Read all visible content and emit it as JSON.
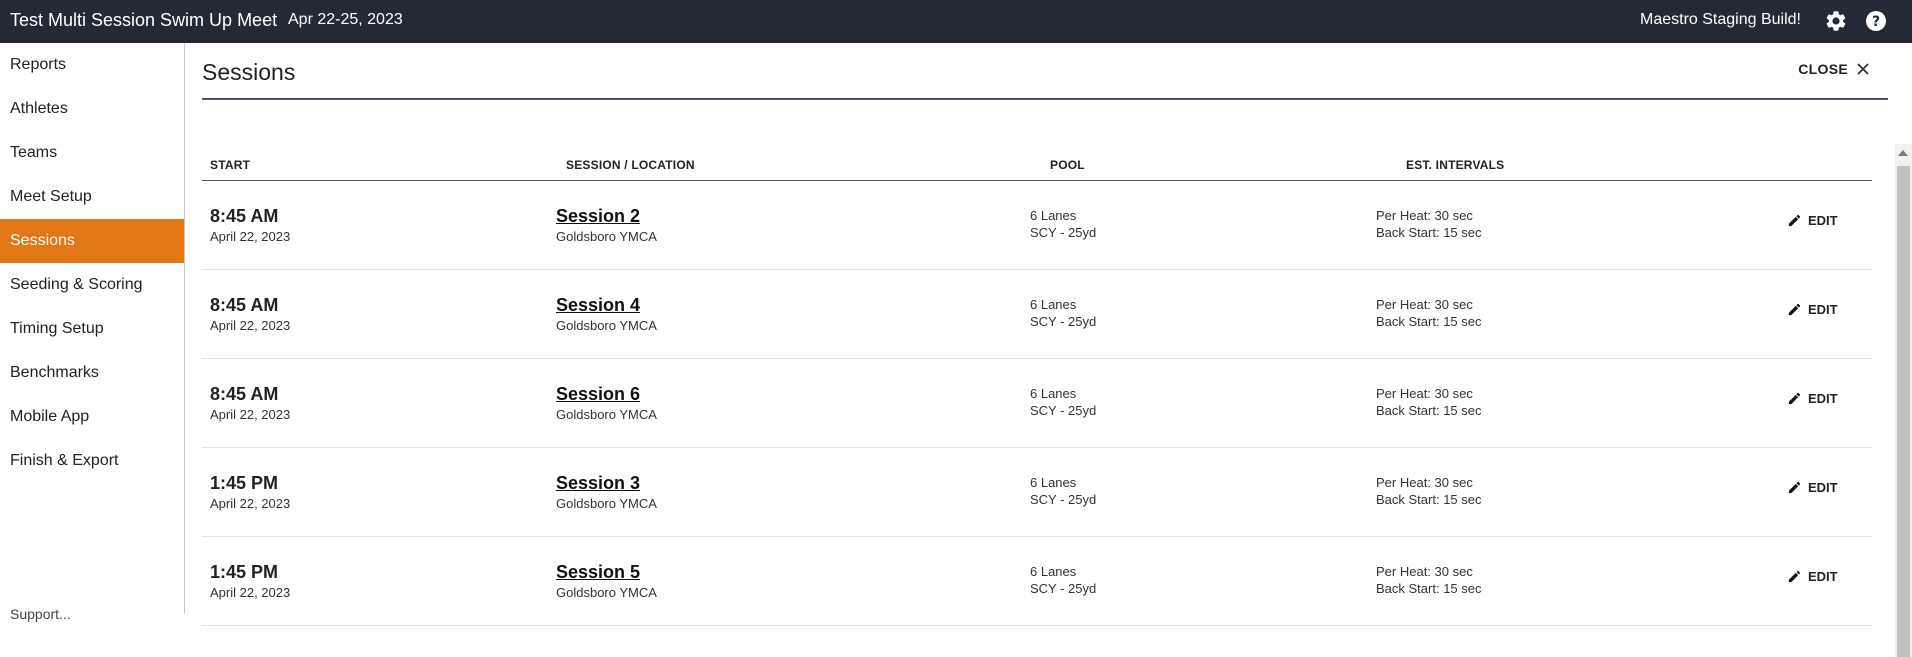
{
  "header": {
    "meet_title": "Test Multi Session Swim Up Meet",
    "meet_dates": "Apr 22-25, 2023",
    "build_label": "Maestro Staging Build!",
    "icons": [
      "gear-icon",
      "help-icon"
    ]
  },
  "sidebar": {
    "items": [
      {
        "label": "Reports"
      },
      {
        "label": "Athletes"
      },
      {
        "label": "Teams"
      },
      {
        "label": "Meet Setup"
      },
      {
        "label": "Sessions",
        "active": true
      },
      {
        "label": "Seeding & Scoring"
      },
      {
        "label": "Timing Setup"
      },
      {
        "label": "Benchmarks"
      },
      {
        "label": "Mobile App"
      },
      {
        "label": "Finish & Export"
      }
    ],
    "overflow_text": "Support..."
  },
  "panel": {
    "title": "Sessions",
    "close_label": "CLOSE"
  },
  "table": {
    "headers": {
      "start": "START",
      "session_location": "SESSION / LOCATION",
      "pool": "POOL",
      "est_intervals": "EST. INTERVALS"
    },
    "edit_label": "EDIT",
    "rows": [
      {
        "time": "8:45 AM",
        "date": "April 22, 2023",
        "session": "Session 2",
        "location": "Goldsboro YMCA",
        "lanes": "6 Lanes",
        "course": "SCY - 25yd",
        "per_heat": "Per Heat: 30 sec",
        "back_start": "Back Start: 15 sec"
      },
      {
        "time": "8:45 AM",
        "date": "April 22, 2023",
        "session": "Session 4",
        "location": "Goldsboro YMCA",
        "lanes": "6 Lanes",
        "course": "SCY - 25yd",
        "per_heat": "Per Heat: 30 sec",
        "back_start": "Back Start: 15 sec"
      },
      {
        "time": "8:45 AM",
        "date": "April 22, 2023",
        "session": "Session 6",
        "location": "Goldsboro YMCA",
        "lanes": "6 Lanes",
        "course": "SCY - 25yd",
        "per_heat": "Per Heat: 30 sec",
        "back_start": "Back Start: 15 sec"
      },
      {
        "time": "1:45 PM",
        "date": "April 22, 2023",
        "session": "Session 3",
        "location": "Goldsboro YMCA",
        "lanes": "6 Lanes",
        "course": "SCY - 25yd",
        "per_heat": "Per Heat: 30 sec",
        "back_start": "Back Start: 15 sec"
      },
      {
        "time": "1:45 PM",
        "date": "April 22, 2023",
        "session": "Session 5",
        "location": "Goldsboro YMCA",
        "lanes": "6 Lanes",
        "course": "SCY - 25yd",
        "per_heat": "Per Heat: 30 sec",
        "back_start": "Back Start: 15 sec"
      }
    ]
  },
  "colors": {
    "topbar_bg": "#242a35",
    "active_nav": "#e27716"
  }
}
